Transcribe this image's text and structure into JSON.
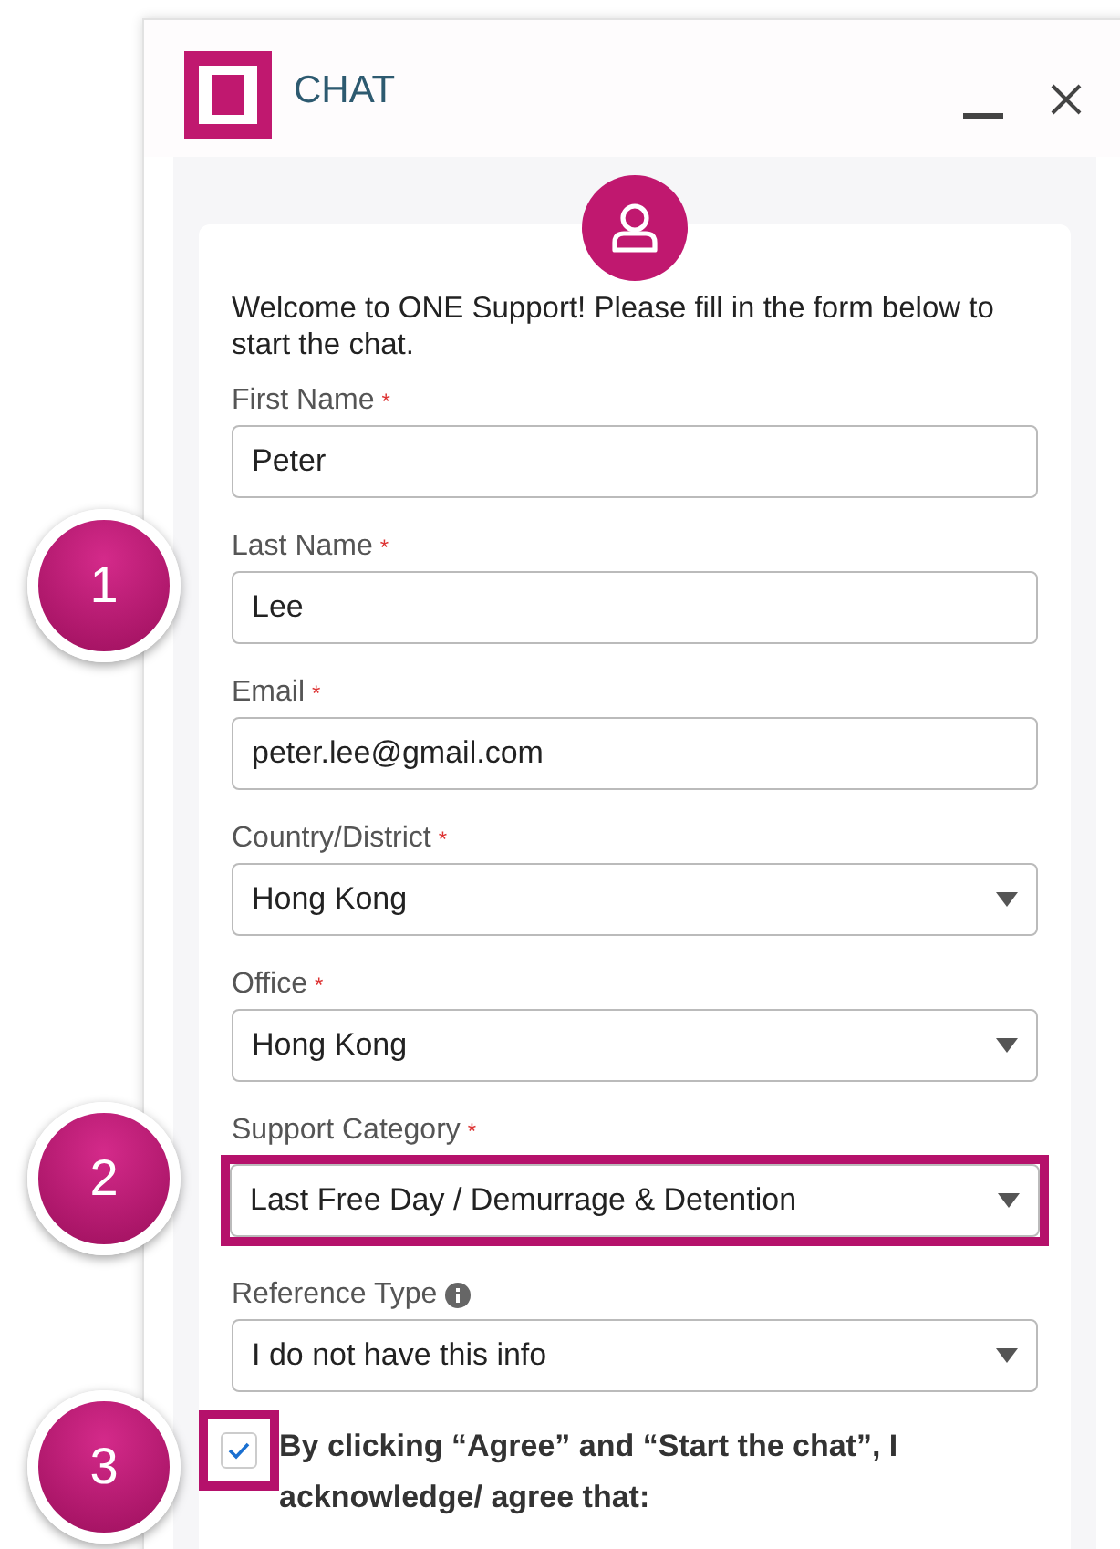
{
  "window": {
    "title": "CHAT"
  },
  "intro": "Welcome to ONE Support! Please fill in the form below to start the chat.",
  "fields": [
    {
      "label": "First Name",
      "kind": "text",
      "required_mark": "*",
      "value": "Peter"
    },
    {
      "label": "Last Name",
      "kind": "text",
      "required_mark": "*",
      "value": "Lee",
      "badge": "1"
    },
    {
      "label": "Email",
      "kind": "text",
      "required_mark": "*",
      "value": "peter.lee@gmail.com"
    },
    {
      "label": "Country/District",
      "kind": "select",
      "required_mark": "*",
      "value": "Hong Kong"
    },
    {
      "label": "Office",
      "kind": "select",
      "required_mark": "*",
      "value": "Hong Kong"
    },
    {
      "label": "Support Category",
      "kind": "select",
      "required_mark": "*",
      "value": "Last Free Day / Demurrage & Detention",
      "highlighted": true,
      "badge": "2"
    },
    {
      "label": "Reference Type",
      "kind": "select",
      "info": true,
      "value": "I do not have this info"
    }
  ],
  "consent": {
    "checked": true,
    "highlighted": true,
    "badge": "3",
    "text": "By clicking “Agree” and “Start the chat”, I acknowledge/ agree that:"
  }
}
